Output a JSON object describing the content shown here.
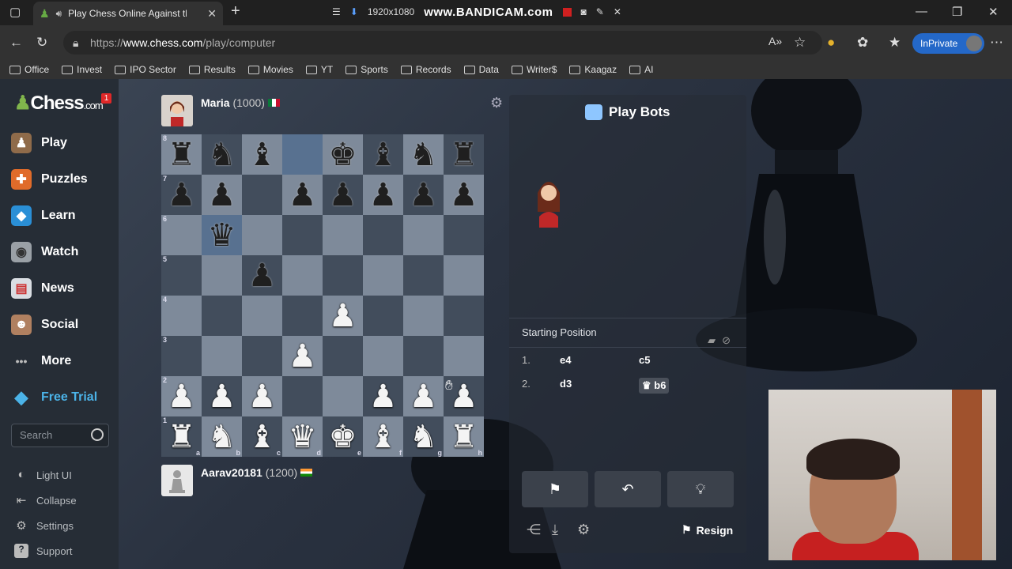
{
  "browser": {
    "tab_title": "Play Chess Online Against th",
    "tab_close": "✕",
    "resolution": "1920x1080",
    "recorder_brand": "www.BANDICAM.com",
    "url_prefix": "https://",
    "url_host": "www.chess.com",
    "url_path": "/play/computer",
    "inprivate_label": "InPrivate",
    "bookmarks": [
      "Office",
      "Invest",
      "IPO Sector",
      "Results",
      "Movies",
      "YT",
      "Sports",
      "Records",
      "Data",
      "Writer$",
      "Kaagaz",
      "AI"
    ]
  },
  "sidebar": {
    "logo": "Chess",
    "logo_suffix": ".com",
    "notification_count": "1",
    "items": [
      {
        "label": "Play",
        "icon": "♟",
        "color": "#8f6b4a"
      },
      {
        "label": "Puzzles",
        "icon": "✚",
        "color": "#e06b2a"
      },
      {
        "label": "Learn",
        "icon": "◆",
        "color": "#2a8fd6"
      },
      {
        "label": "Watch",
        "icon": "◉",
        "color": "#bbbbbb"
      },
      {
        "label": "News",
        "icon": "▤",
        "color": "#d9dde2"
      },
      {
        "label": "Social",
        "icon": "☻",
        "color": "#b08060"
      },
      {
        "label": "More",
        "icon": "•••",
        "color": "transparent"
      },
      {
        "label": "Free Trial",
        "icon": "◆",
        "color": "transparent"
      }
    ],
    "search_placeholder": "Search",
    "footer": [
      {
        "label": "Light UI",
        "icon": "◐"
      },
      {
        "label": "Collapse",
        "icon": "⇤"
      },
      {
        "label": "Settings",
        "icon": "⚙"
      },
      {
        "label": "Support",
        "icon": "?"
      }
    ]
  },
  "game": {
    "opponent_name": "Maria",
    "opponent_rating": "(1000)",
    "player_name": "Aarav20181",
    "player_rating": "(1200)",
    "board": [
      [
        "r",
        "n",
        "b",
        "",
        "k",
        "b",
        "n",
        "r"
      ],
      [
        "p",
        "p",
        "",
        "p",
        "p",
        "p",
        "p",
        "p"
      ],
      [
        "",
        "q",
        "",
        "",
        "",
        "",
        "",
        ""
      ],
      [
        "",
        "",
        "p",
        "",
        "",
        "",
        "",
        ""
      ],
      [
        "",
        "",
        "",
        "",
        "P",
        "",
        "",
        ""
      ],
      [
        "",
        "",
        "",
        "P",
        "",
        "",
        "",
        ""
      ],
      [
        "P",
        "P",
        "P",
        "",
        "",
        "P",
        "P",
        "P"
      ],
      [
        "R",
        "N",
        "B",
        "Q",
        "K",
        "B",
        "N",
        "R"
      ]
    ],
    "highlight_squares": [
      "d8",
      "b6"
    ],
    "rank_labels": [
      "8",
      "7",
      "6",
      "5",
      "4",
      "3",
      "2",
      "1"
    ],
    "file_labels": [
      "a",
      "b",
      "c",
      "d",
      "e",
      "f",
      "g",
      "h"
    ]
  },
  "panel": {
    "title": "Play Bots",
    "moves_header": "Starting Position",
    "moves": [
      {
        "num": "1.",
        "white": "e4",
        "black": "c5"
      },
      {
        "num": "2.",
        "white": "d3",
        "black": "b6"
      }
    ],
    "black_last_piece_icon": "♛",
    "resign_label": "Resign"
  }
}
